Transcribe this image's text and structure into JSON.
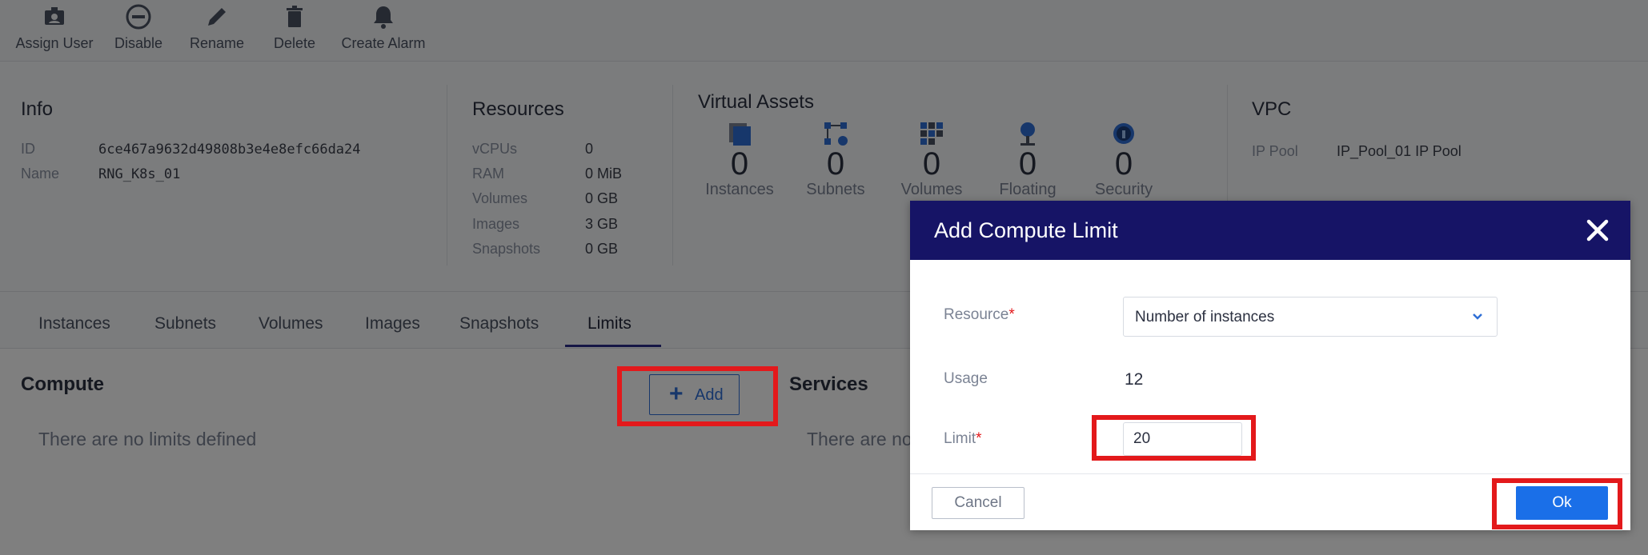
{
  "toolbar": {
    "items": [
      {
        "label": "Assign User",
        "icon": "assign-user-icon"
      },
      {
        "label": "Disable",
        "icon": "disable-icon"
      },
      {
        "label": "Rename",
        "icon": "pencil-icon"
      },
      {
        "label": "Delete",
        "icon": "trash-icon"
      },
      {
        "label": "Create Alarm",
        "icon": "bell-icon"
      }
    ]
  },
  "info": {
    "title": "Info",
    "id_label": "ID",
    "id_value": "6ce467a9632d49808b3e4e8efc66da24",
    "name_label": "Name",
    "name_value": "RNG_K8s_01"
  },
  "resources": {
    "title": "Resources",
    "rows": [
      {
        "label": "vCPUs",
        "value": "0"
      },
      {
        "label": "RAM",
        "value": "0 MiB"
      },
      {
        "label": "Volumes",
        "value": "0 GB"
      },
      {
        "label": "Images",
        "value": "3 GB"
      },
      {
        "label": "Snapshots",
        "value": "0 GB"
      }
    ]
  },
  "virtual_assets": {
    "title": "Virtual Assets",
    "items": [
      {
        "count": "0",
        "label": "Instances",
        "icon": "instances-icon"
      },
      {
        "count": "0",
        "label": "Subnets",
        "icon": "subnets-icon"
      },
      {
        "count": "0",
        "label": "Volumes",
        "icon": "volumes-icon"
      },
      {
        "count": "0",
        "label": "Floating",
        "icon": "floating-ip-icon"
      },
      {
        "count": "0",
        "label": "Security",
        "icon": "security-icon"
      }
    ]
  },
  "vpc": {
    "title": "VPC",
    "ip_pool_label": "IP Pool",
    "ip_pool_value": "IP_Pool_01 IP Pool"
  },
  "tabs": [
    {
      "label": "Instances"
    },
    {
      "label": "Subnets"
    },
    {
      "label": "Volumes"
    },
    {
      "label": "Images"
    },
    {
      "label": "Snapshots"
    },
    {
      "label": "Limits",
      "active": true
    }
  ],
  "compute": {
    "title": "Compute",
    "add_label": "Add",
    "empty_text": "There are no limits defined"
  },
  "services": {
    "title": "Services",
    "empty_text": "There are no"
  },
  "modal": {
    "title": "Add Compute Limit",
    "resource_label": "Resource",
    "resource_value": "Number of instances",
    "usage_label": "Usage",
    "usage_value": "12",
    "limit_label": "Limit",
    "limit_value": "20",
    "cancel_label": "Cancel",
    "ok_label": "Ok",
    "required_mark": "*"
  },
  "colors": {
    "modal_header": "#161466",
    "primary": "#1a6fe8",
    "highlight": "#e3191b",
    "tab_active_underline": "#2b2d8a"
  }
}
